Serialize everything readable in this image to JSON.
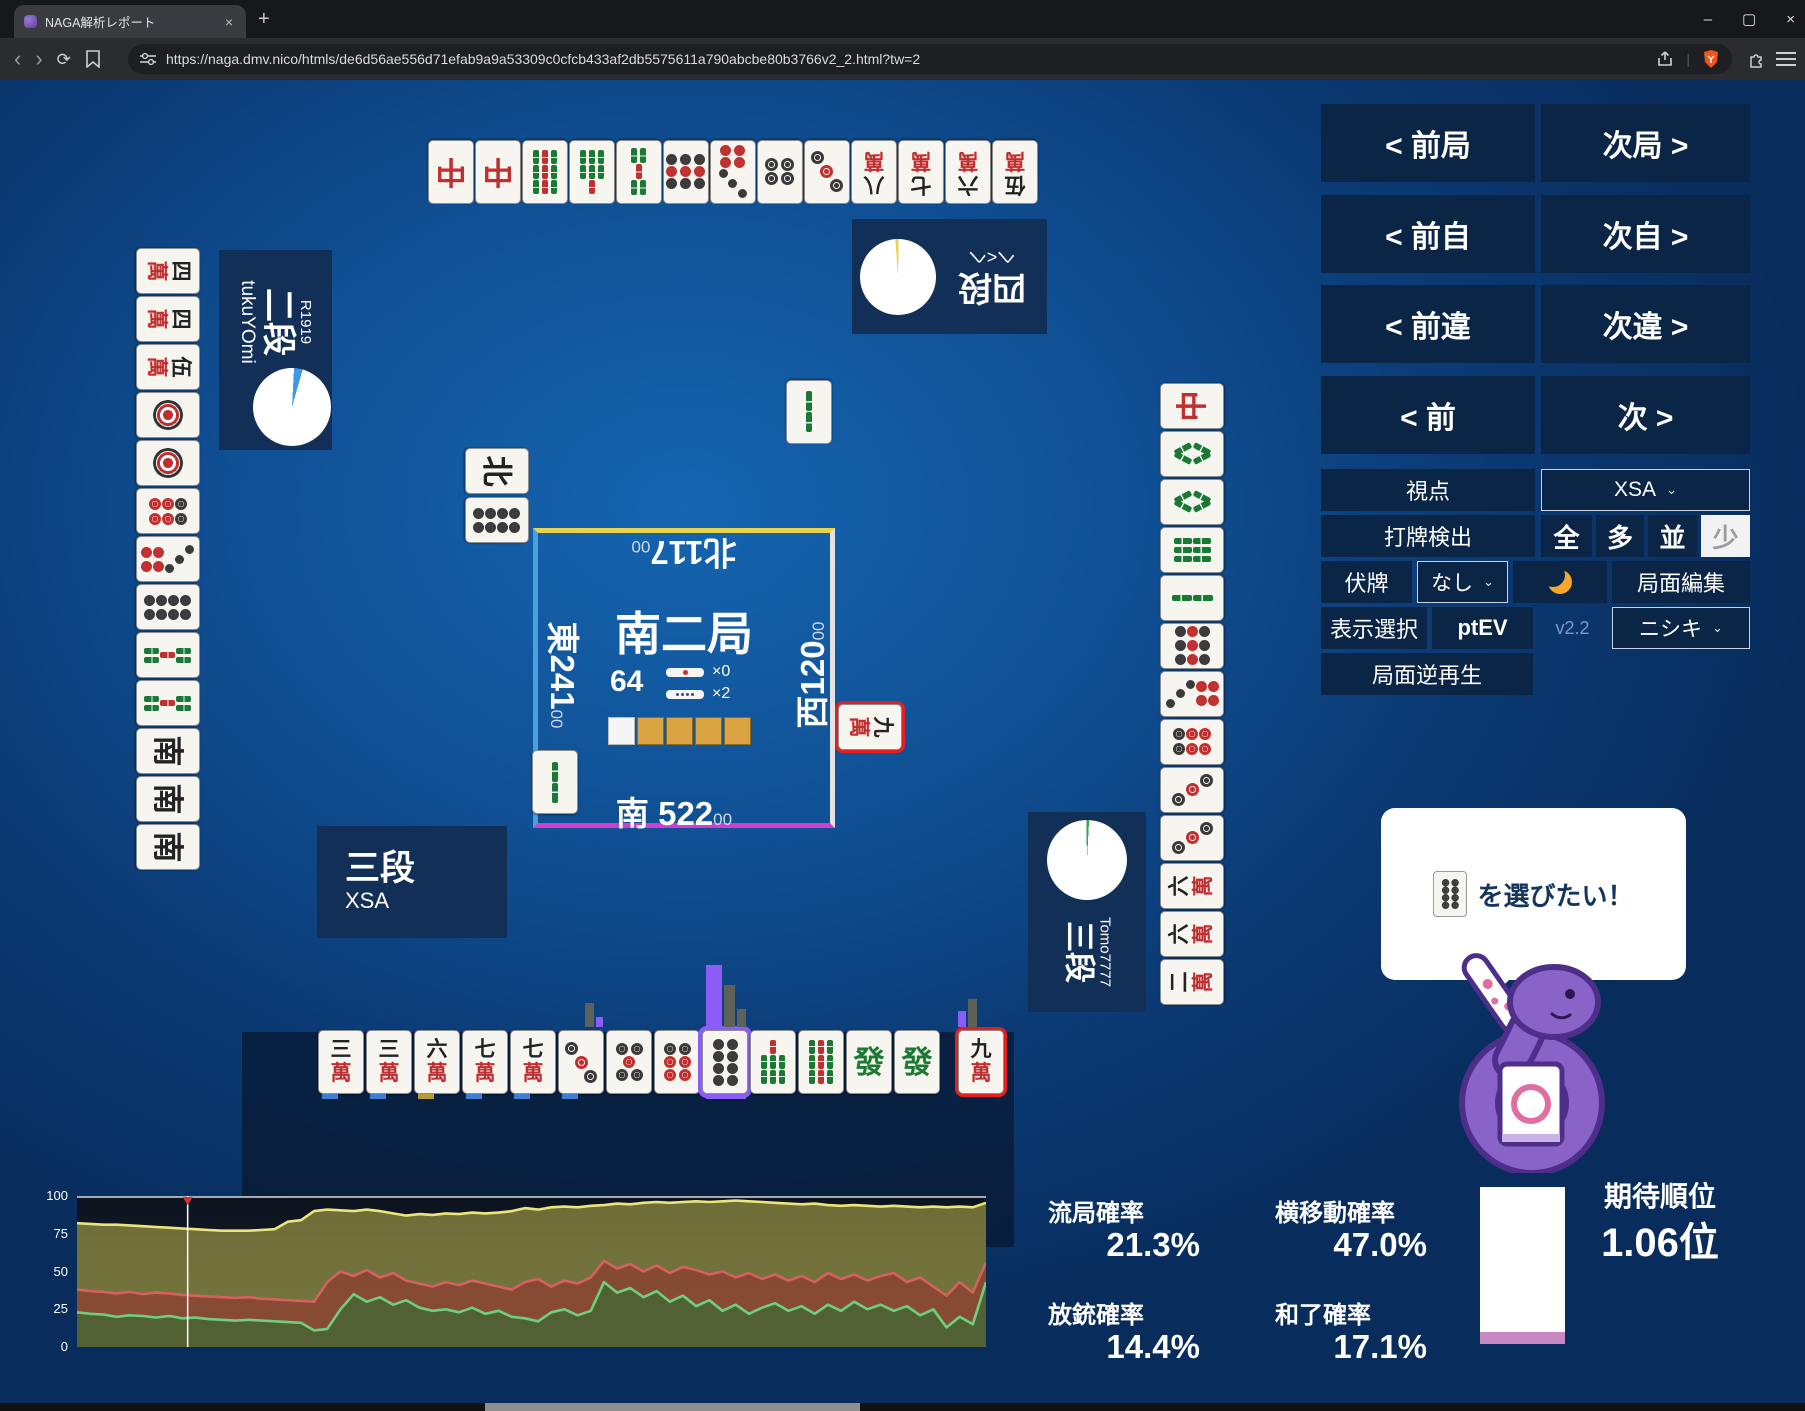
{
  "browser": {
    "tab_title": "NAGA解析レポート",
    "tab_close": "×",
    "new_tab": "+",
    "url": "https://naga.dmv.nico/htmls/de6d56ae556d71efab9a9a53309c0cfcb433af2db5575611a790abcbe80b3766v2_2.html?tw=2",
    "window": {
      "minimize": "–",
      "maximize": "▢",
      "close": "×"
    },
    "back": "‹",
    "forward": "›",
    "reload": "⟳"
  },
  "nav": {
    "rows": [
      {
        "left": "< 前局",
        "right": "次局 >"
      },
      {
        "left": "< 前自",
        "right": "次自 >"
      },
      {
        "left": "< 前違",
        "right": "次違 >"
      },
      {
        "left": "< 前",
        "right": "次 >"
      }
    ]
  },
  "controls": {
    "viewpoint_label": "視点",
    "viewpoint_value": "XSA",
    "dahai_label": "打牌検出",
    "dahai_options": [
      "全",
      "多",
      "並",
      "少"
    ],
    "dahai_selected": "少",
    "fusehai_label": "伏牌",
    "fusehai_value": "なし",
    "moon_icon": "moon-icon",
    "edit_label": "局面編集",
    "display_label": "表示選択",
    "ptev_label": "ptEV",
    "version": "v2.2",
    "model_value": "ニシキ",
    "replay_label": "局面逆再生"
  },
  "board": {
    "round": "南二局",
    "wall_count": "64",
    "riichi_stick_count": "×0",
    "honba_stick_count": "×2",
    "seats": {
      "east": {
        "wind": "東",
        "score": "241",
        "sub": "00"
      },
      "south": {
        "wind": "南",
        "score": "522",
        "sub": "00"
      },
      "west": {
        "wind": "西",
        "score": "120",
        "sub": "00"
      },
      "north": {
        "wind": "北",
        "score": "117",
        "sub": "00"
      }
    },
    "turn_cells": [
      "white",
      "amber",
      "amber",
      "amber",
      "amber"
    ]
  },
  "players": {
    "left": {
      "rank": "二段",
      "name": "tukuYOmi",
      "rating": "R1919",
      "color": "#3b9ae1"
    },
    "top": {
      "rank": "四段",
      "name": "へ<へ",
      "color": "#e8d44d"
    },
    "right": {
      "rank": "三段",
      "name": "Tomo7777",
      "color": "#3aa24a"
    },
    "bottom": {
      "rank": "三段",
      "name": "XSA"
    }
  },
  "tiles": {
    "top_discard_row": [
      "chun",
      "chun",
      "s9",
      "s7",
      "s5",
      "p9",
      "p7",
      "p4",
      "p3",
      "m8",
      "m7",
      "m6",
      "m5"
    ],
    "left_discard_col": [
      "m4",
      "m4",
      "m5",
      "p1",
      "p1",
      "p6",
      "p7",
      "p8",
      "s5",
      "s5",
      "south",
      "south",
      "south"
    ],
    "right_discard_col": [
      "chun",
      "s8",
      "s8",
      "s6",
      "s2",
      "p9",
      "p7",
      "p6",
      "p3",
      "p3",
      "m6",
      "m6",
      "m2"
    ],
    "hand": [
      "m3",
      "m3",
      "m6",
      "m7",
      "m7",
      "p3",
      "p5",
      "p6",
      "p8",
      "s7",
      "s9",
      "hatsu",
      "hatsu"
    ],
    "drawn": "m9",
    "recommended": "p8",
    "around_board": {
      "top": "s2",
      "left_pair": [
        "north",
        "p8"
      ],
      "bottom": "s2",
      "right_red": "m9"
    }
  },
  "bubble": {
    "tile": "p8",
    "text": "を選びたい！"
  },
  "stats": {
    "items": [
      {
        "label": "流局確率",
        "value": "21.3%"
      },
      {
        "label": "横移動確率",
        "value": "47.0%"
      },
      {
        "label": "放銃確率",
        "value": "14.4%"
      },
      {
        "label": "和了確率",
        "value": "17.1%"
      }
    ],
    "rank_label": "期待順位",
    "rank_value": "1.06位"
  },
  "chart_data": {
    "type": "area",
    "title": "",
    "xlabel": "",
    "ylabel": "",
    "ylim": [
      0,
      100
    ],
    "yticks": [
      100,
      75,
      50,
      25,
      0
    ],
    "grid": false,
    "cursor_index": 8.4,
    "series": [
      {
        "name": "yellow",
        "line": "#ece67a",
        "fill": "rgba(210,200,80,0.50)",
        "values": [
          82,
          81.5,
          81,
          81,
          80.5,
          80,
          79.5,
          79,
          78.5,
          78,
          77.5,
          77,
          77,
          77,
          77.5,
          78,
          83,
          84,
          90,
          91,
          90.5,
          90,
          91,
          90,
          88.5,
          87,
          88,
          87.5,
          88.5,
          88,
          89,
          88.5,
          89,
          90,
          92,
          91,
          92.5,
          93,
          92.5,
          93.5,
          94,
          95,
          94.5,
          95.5,
          96,
          95.5,
          96,
          96.5,
          96,
          96.5,
          97,
          96.5,
          96,
          95.5,
          95,
          94.5,
          95,
          94,
          93.5,
          94,
          93.5,
          93,
          93.5,
          93,
          92.5,
          93,
          92.5,
          93,
          92.5,
          95.5
        ]
      },
      {
        "name": "red",
        "line": "#d86060",
        "fill": "rgba(150,42,42,0.55)",
        "values": [
          38,
          37,
          36.5,
          35.5,
          36.5,
          35,
          36,
          35.5,
          34.5,
          34,
          33.5,
          33,
          32.5,
          33,
          32,
          31.5,
          31,
          30.5,
          30,
          43,
          50,
          47,
          51,
          46,
          49,
          44,
          42,
          40,
          43,
          41,
          44,
          42,
          40,
          38,
          43,
          45,
          40,
          44,
          42,
          46,
          57,
          52,
          55,
          50,
          54,
          49,
          53,
          51,
          48,
          50,
          46,
          49,
          45,
          48,
          44,
          47,
          43,
          49,
          45,
          48,
          44,
          47,
          49,
          43,
          46,
          40,
          34,
          43,
          36,
          56
        ]
      },
      {
        "name": "green",
        "line": "#6fcf7f",
        "fill": "rgba(46,112,52,0.60)",
        "values": [
          23,
          22,
          21.5,
          20,
          21,
          20.5,
          19.5,
          20.5,
          19,
          19.5,
          18.5,
          18,
          17.5,
          18,
          17.5,
          17,
          16.5,
          16,
          11,
          12,
          25,
          35,
          30,
          33,
          28,
          31,
          26,
          24,
          25,
          23,
          26,
          22,
          24,
          20,
          19,
          17,
          23,
          25,
          21,
          24,
          43,
          36,
          39,
          33,
          37,
          30,
          34,
          27,
          31,
          24,
          28,
          22,
          26,
          29,
          24,
          27,
          22,
          28,
          24,
          30,
          25,
          28,
          24,
          27,
          21,
          25,
          13,
          20,
          15,
          43
        ]
      }
    ]
  }
}
